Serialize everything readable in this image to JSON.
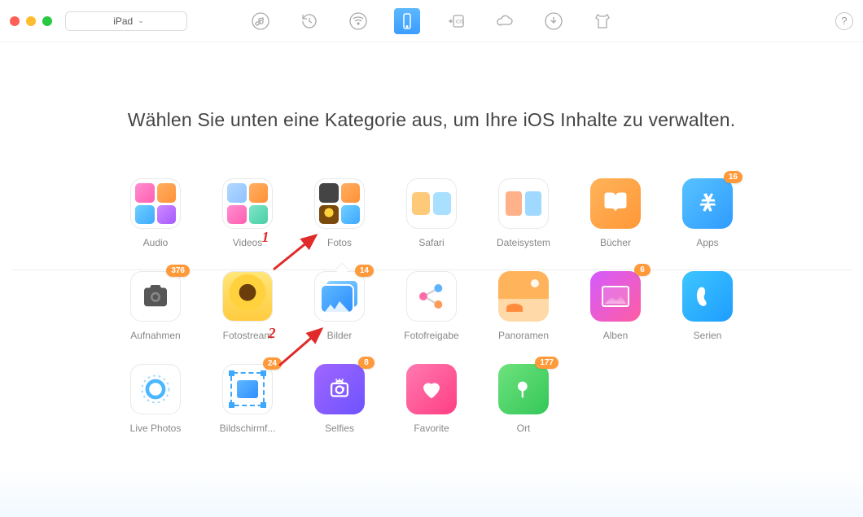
{
  "device_selector": {
    "label": "iPad"
  },
  "help_label": "?",
  "headline": "Wählen Sie unten eine Kategorie aus, um Ihre iOS Inhalte zu verwalten.",
  "nav": {
    "items": [
      "music",
      "history",
      "wifi",
      "phone",
      "to-ios",
      "cloud",
      "download",
      "tshirt"
    ],
    "active_index": 3
  },
  "top_categories": [
    {
      "label": "Audio",
      "type": "quad",
      "badge": null
    },
    {
      "label": "Videos",
      "type": "quad",
      "badge": null
    },
    {
      "label": "Fotos",
      "type": "quad",
      "badge": null,
      "selected": true
    },
    {
      "label": "Safari",
      "type": "dual",
      "badge": null
    },
    {
      "label": "Dateisystem",
      "type": "dual",
      "badge": null
    },
    {
      "label": "Bücher",
      "type": "books",
      "badge": null
    },
    {
      "label": "Apps",
      "type": "apps",
      "badge": "16"
    }
  ],
  "sub_categories_row1": [
    {
      "label": "Aufnahmen",
      "icon": "camera",
      "badge": "376"
    },
    {
      "label": "Fotostream",
      "icon": "sunflower",
      "badge": null
    },
    {
      "label": "Bilder",
      "icon": "pictures",
      "badge": "14"
    },
    {
      "label": "Fotofreigabe",
      "icon": "share",
      "badge": null
    },
    {
      "label": "Panoramen",
      "icon": "panorama",
      "badge": null
    },
    {
      "label": "Alben",
      "icon": "album",
      "badge": "6"
    },
    {
      "label": "Serien",
      "icon": "series",
      "badge": null
    }
  ],
  "sub_categories_row2": [
    {
      "label": "Live Photos",
      "icon": "livephotos",
      "badge": null
    },
    {
      "label": "Bildschirmf...",
      "icon": "screenshot",
      "badge": "24"
    },
    {
      "label": "Selfies",
      "icon": "selfies",
      "badge": "8"
    },
    {
      "label": "Favorite",
      "icon": "favorite",
      "badge": null
    },
    {
      "label": "Ort",
      "icon": "location",
      "badge": "177"
    }
  ],
  "annotations": {
    "a1": "1",
    "a2": "2"
  }
}
